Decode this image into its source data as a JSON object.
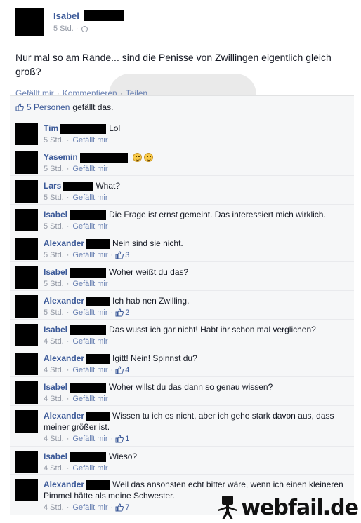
{
  "post": {
    "author": "Isabel",
    "time": "5 Std.",
    "meta_sep": "·",
    "text": "Nur mal so am Rande... sind die Penisse von Zwillingen eigentlich gleich groß?",
    "actions": {
      "like": "Gefällt mir",
      "comment": "Kommentieren",
      "share": "Teilen",
      "sep": "·"
    }
  },
  "likes": {
    "count": "5 Personen",
    "tail": "gefällt das."
  },
  "comments": [
    {
      "name": "Tim",
      "text": "Lol",
      "time": "5 Std.",
      "like": "Gefällt mir",
      "likes": ""
    },
    {
      "name": "Yasemin",
      "text": "",
      "time": "5 Std.",
      "like": "Gefällt mir",
      "likes": ""
    },
    {
      "name": "Lars",
      "text": "What?",
      "time": "5 Std.",
      "like": "Gefällt mir",
      "likes": ""
    },
    {
      "name": "Isabel",
      "text": "Die Frage ist ernst gemeint. Das interessiert mich wirklich.",
      "time": "5 Std.",
      "like": "Gefällt mir",
      "likes": ""
    },
    {
      "name": "Alexander",
      "text": "Nein sind sie nicht.",
      "time": "5 Std.",
      "like": "Gefällt mir",
      "likes": "3"
    },
    {
      "name": "Isabel",
      "text": "Woher weißt du das?",
      "time": "5 Std.",
      "like": "Gefällt mir",
      "likes": ""
    },
    {
      "name": "Alexander",
      "text": "Ich hab nen Zwilling.",
      "time": "5 Std.",
      "like": "Gefällt mir",
      "likes": "2"
    },
    {
      "name": "Isabel",
      "text": "Das wusst ich gar nicht! Habt ihr schon mal verglichen?",
      "time": "4 Std.",
      "like": "Gefällt mir",
      "likes": ""
    },
    {
      "name": "Alexander",
      "text": "Igitt! Nein! Spinnst du?",
      "time": "4 Std.",
      "like": "Gefällt mir",
      "likes": "4"
    },
    {
      "name": "Isabel",
      "text": "Woher willst du das dann so genau wissen?",
      "time": "4 Std.",
      "like": "Gefällt mir",
      "likes": ""
    },
    {
      "name": "Alexander",
      "text": "Wissen tu ich es nicht, aber ich gehe stark davon aus, dass meiner größer ist.",
      "time": "4 Std.",
      "like": "Gefällt mir",
      "likes": "1"
    },
    {
      "name": "Isabel",
      "text": "Wieso?",
      "time": "4 Std.",
      "like": "Gefällt mir",
      "likes": ""
    },
    {
      "name": "Alexander",
      "text": "Weil das ansonsten echt bitter wäre, wenn ich einen kleineren Pimmel hätte als meine Schwester.",
      "time": "4 Std.",
      "like": "Gefällt mir",
      "likes": "7"
    }
  ],
  "brand": {
    "text": "webfail.de",
    "icon": "stick-figure-icon"
  },
  "colors": {
    "link": "#3b5998",
    "meta": "#9197a3",
    "bg": "#f6f7f8"
  }
}
